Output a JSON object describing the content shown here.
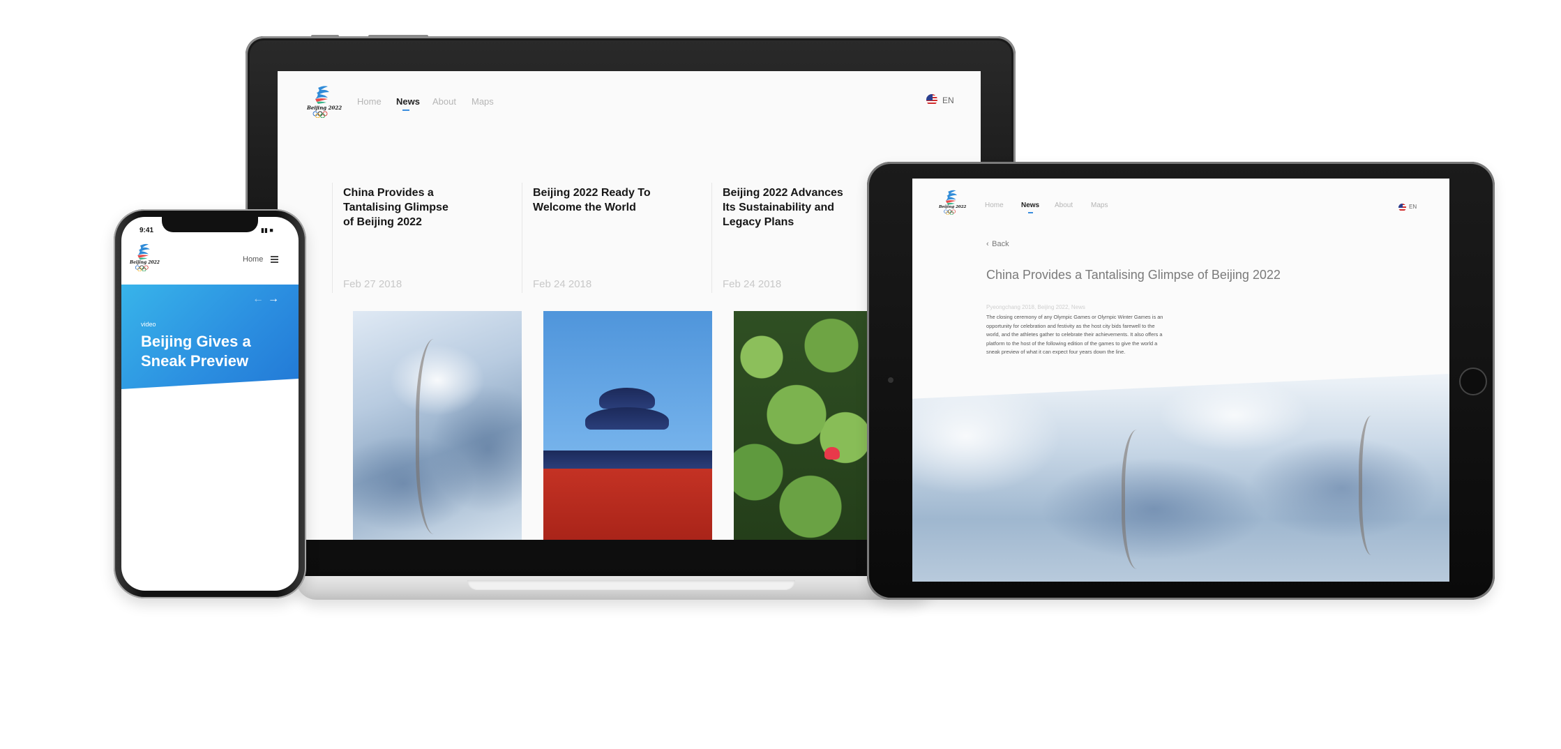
{
  "brand": {
    "logo_text": "Beijing 2022"
  },
  "nav": {
    "items": [
      "Home",
      "News",
      "About",
      "Maps"
    ],
    "active": "News",
    "language": "EN"
  },
  "laptop": {
    "cards": [
      {
        "title_lines": [
          "China Provides a",
          "Tantalising Glimpse",
          "of Beijing 2022"
        ],
        "date": "Feb 27 2018"
      },
      {
        "title_lines": [
          "Beijing 2022 Ready To",
          "Welcome the World"
        ],
        "date": "Feb 24 2018"
      },
      {
        "title_lines": [
          "Beijing 2022 Advances",
          "Its Sustainability and",
          "Legacy Plans"
        ],
        "date": "Feb 24 2018"
      }
    ]
  },
  "phone": {
    "time": "9:41",
    "nav_label": "Home",
    "hero_tag": "video",
    "hero_title_lines": [
      "Beijing Gives a",
      "Sneak Preview"
    ]
  },
  "tablet": {
    "back_label": "Back",
    "title": "China Provides a Tantalising Glimpse of Beijing 2022",
    "tags": "Pyeongchang 2018, Beijing 2022, News",
    "body_lines": [
      "The closing ceremony of any Olympic Games or Olympic Winter Games is an",
      "opportunity for celebration and festivity as the host city bids farewell to the",
      "world, and the athletes gather to celebrate their achievements. It also offers a",
      "platform to the host of the following edition of the games to give the world a",
      "sneak preview of what it can expect four years down the line."
    ]
  },
  "colors": {
    "accent": "#3a8dde",
    "hero_blue": "#2b8ee0"
  }
}
